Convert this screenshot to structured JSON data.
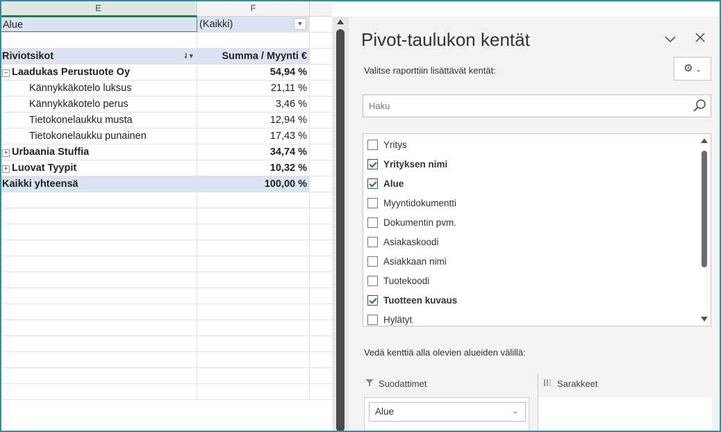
{
  "sheet": {
    "columns": [
      "E",
      "F"
    ],
    "filter_label": "Alue",
    "filter_value": "(Kaikki)",
    "pivot_header": {
      "row_label": "Riviotsikot",
      "value_label": "Summa  / Myynti €"
    },
    "groups": [
      {
        "name": "Laadukas Perustuote Oy",
        "value": "54,94 %",
        "expanded": true,
        "children": [
          {
            "name": "Kännykkäkotelo luksus",
            "value": "21,11 %"
          },
          {
            "name": "Kännykkäkotelo perus",
            "value": "3,46 %"
          },
          {
            "name": "Tietokonelaukku musta",
            "value": "12,94 %"
          },
          {
            "name": "Tietokonelaukku punainen",
            "value": "17,43 %"
          }
        ]
      },
      {
        "name": "Urbaania Stuffia",
        "value": "34,74 %",
        "expanded": false
      },
      {
        "name": "Luovat Tyypit",
        "value": "10,32 %",
        "expanded": false
      }
    ],
    "grand_total": {
      "label": "Kaikki yhteensä",
      "value": "100,00 %"
    }
  },
  "pane": {
    "title": "Pivot-taulukon kentät",
    "subtitle": "Valitse raporttiin lisättävät kentät:",
    "search_placeholder": "Haku",
    "fields": [
      {
        "label": "Yritys",
        "checked": false
      },
      {
        "label": "Yrityksen nimi",
        "checked": true
      },
      {
        "label": "Alue",
        "checked": true
      },
      {
        "label": "Myyntidokumentti",
        "checked": false
      },
      {
        "label": "Dokumentin pvm.",
        "checked": false
      },
      {
        "label": "Asiakaskoodi",
        "checked": false
      },
      {
        "label": "Asiakkaan nimi",
        "checked": false
      },
      {
        "label": "Tuotekoodi",
        "checked": false
      },
      {
        "label": "Tuotteen kuvaus",
        "checked": true
      },
      {
        "label": "Hylätyt",
        "checked": false
      }
    ],
    "drag_hint": "Vedä kenttiä alla olevien alueiden välillä:",
    "areas": {
      "filters_label": "Suodattimet",
      "columns_label": "Sarakkeet",
      "filter_items": [
        "Alue"
      ]
    },
    "icons": {
      "collapse": "chevron-down-icon",
      "close": "close-icon",
      "settings": "gear-icon",
      "search": "search-icon",
      "filter": "funnel-icon",
      "columns": "columns-icon"
    },
    "colors": {
      "accent": "#107c41",
      "header_fill": "#dbe3f3",
      "pane_bg": "#f3f3f3"
    }
  }
}
